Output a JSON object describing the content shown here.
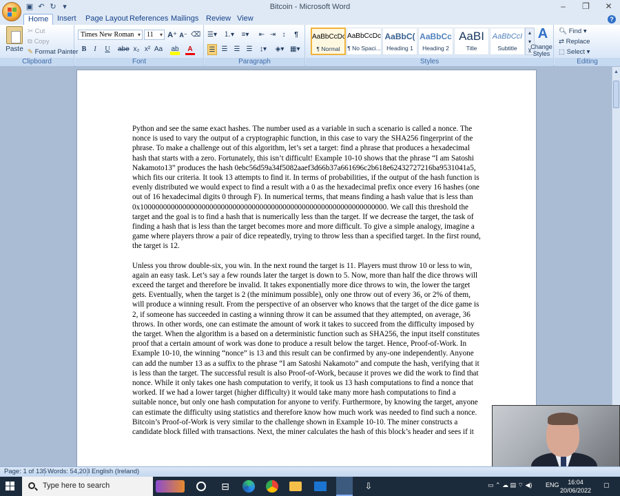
{
  "window": {
    "title": "Bitcoin - Microsoft Word",
    "controls": {
      "minimize": "–",
      "restore": "❐",
      "close": "✕"
    }
  },
  "quick_access": [
    "save-icon",
    "undo-icon",
    "redo-icon"
  ],
  "tabs": [
    "Home",
    "Insert",
    "Page Layout",
    "References",
    "Mailings",
    "Review",
    "View"
  ],
  "active_tab": "Home",
  "ribbon": {
    "clipboard": {
      "label": "Clipboard",
      "paste": "Paste",
      "cut": "Cut",
      "copy": "Copy",
      "format_painter": "Format Painter"
    },
    "font": {
      "label": "Font",
      "font_name": "Times New Roman",
      "font_size": "11",
      "bold": "B",
      "italic": "I",
      "underline": "U",
      "strike": "abe",
      "subscript": "x₂",
      "superscript": "x²",
      "change_case": "Aa",
      "grow": "A",
      "shrink": "A"
    },
    "paragraph": {
      "label": "Paragraph"
    },
    "styles": {
      "label": "Styles",
      "items": [
        {
          "sample": "AaBbCcDc",
          "name": "¶ Normal"
        },
        {
          "sample": "AaBbCcDc",
          "name": "¶ No Spaci..."
        },
        {
          "sample": "AaBbC(",
          "name": "Heading 1"
        },
        {
          "sample": "AaBbCc",
          "name": "Heading 2"
        },
        {
          "sample": "AaBI",
          "name": "Title"
        },
        {
          "sample": "AaBbCcI",
          "name": "Subtitle"
        }
      ],
      "change_styles": "Change Styles"
    },
    "editing": {
      "label": "Editing",
      "find": "Find",
      "replace": "Replace",
      "select": "Select"
    }
  },
  "document": {
    "paragraphs": [
      "Python and see the same exact hashes. The number used as a variable in such a scenario is called a nonce. The nonce is used to vary the output of a cryptographic function, in this case to vary the SHA256 fingerprint of the phrase. To make a challenge out of this algorithm, let’s set a target: find a phrase that produces a hexadecimal hash that starts with a zero. Fortunately, this isn’t difficult! Example 10-10 shows that the phrase “I am Satoshi Nakamoto13” produces the hash 0ebc56d59a34f5082aaef3d66b37a661696c2b618e62432727216ba9531041a5, which fits our criteria. It took 13 attempts to find it. In terms of probabilities, if the output of the hash function is evenly distributed we would expect to find a result with a 0 as the hexadecimal prefix once every 16 hashes (one out of 16 hexadecimal digits 0 through F). In numerical terms, that means finding a hash value that is less than 0x1000000000000000000000000000000000000000000000000000000000000000. We call this threshold the target and the goal is to find a hash that is numerically less than the target. If we decrease the target, the task of finding a hash that is less than the target becomes more and more difficult. To give a simple analogy, imagine a game where players throw a pair of dice repeatedly, trying to throw less than a specified target. In the first round, the target is 12.",
      "Unless you throw double-six, you win. In the next round the target is 11. Players must throw 10 or less to win, again an easy task. Let’s say a few rounds later the target is down to 5. Now, more than half the dice throws will exceed the target and therefore be invalid. It takes exponentially more dice throws to win, the lower the target gets. Eventually, when the target is 2 (the minimum possible), only one throw out of every 36, or 2% of them, will produce a winning result. From the perspective of an observer who knows that the target of the dice game is 2, if someone has succeeded in casting a winning throw it can be assumed that they attempted, on average, 36 throws. In other words, one can estimate the amount of work it takes to succeed from the difficulty imposed by the target. When the algorithm is a based on a deterministic function such as SHA256, the input itself constitutes proof that a certain amount of work was done to produce a result below the target. Hence, Proof-of-Work. In Example 10-10, the winning “nonce” is 13 and this result can be confirmed by any-one independently. Anyone can add the number 13 as a suffix to the phrase “I am Satoshi Nakamoto” and compute the hash, verifying that it is less than the target. The successful result is also Proof-of-Work, because it proves we did the work to find that nonce. While it only takes one hash computation to verify, it took us 13 hash computations to find a nonce that worked. If we had a lower target (higher difficulty) it would take many more hash computations to find a suitable nonce, but only one hash computation for anyone to verify. Furthermore, by knowing the target, anyone can estimate the difficulty using statistics and therefore know how much work was needed to find such a nonce. Bitcoin’s Proof-of-Work is very similar to the challenge shown in Example 10-10. The miner constructs a candidate block filled with transactions. Next, the miner calculates the hash of this block’s header and sees if it"
    ]
  },
  "status": {
    "page": "Page: 1 of 135",
    "words": "Words: 54,203",
    "language": "English (Ireland)"
  },
  "taskbar": {
    "search_placeholder": "Type here to search",
    "language": "ENG",
    "time": "16:04",
    "date": "20/06/2022"
  },
  "colors": {
    "ribbon_blue": "#dfe9f5",
    "accent": "#15428b",
    "taskbar": "#1c2b3b"
  }
}
